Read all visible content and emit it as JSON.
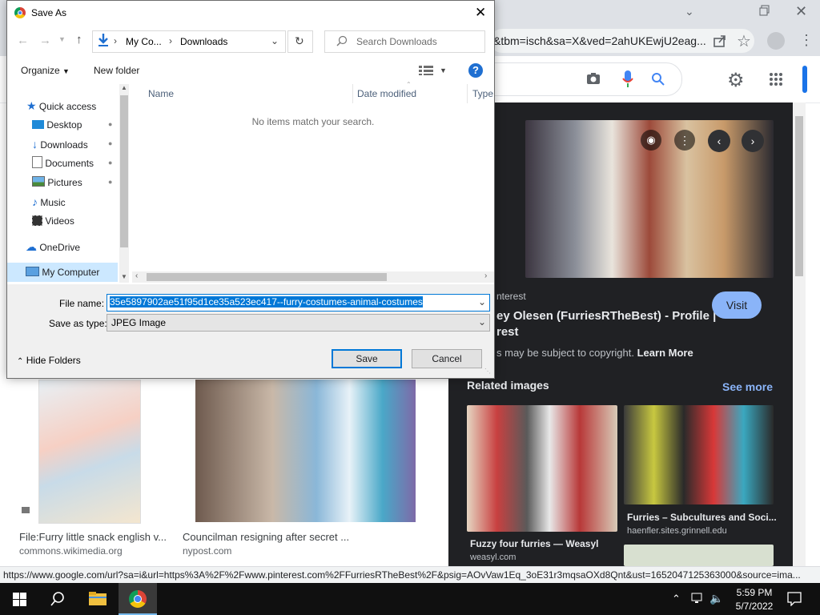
{
  "browser": {
    "url": "&tbm=isch&sa=X&ved=2ahUKEwjU2eag...",
    "status_url": "https://www.google.com/url?sa=i&url=https%3A%2F%2Fwww.pinterest.com%2FFurriesRTheBest%2F&psig=AOvVaw1Eq_3oE31r3mqsaOXd8Qnt&ust=1652047125363000&source=ima..."
  },
  "google": {
    "panel": {
      "source": "nterest",
      "title_line1": "ey Olesen (FurriesRTheBest) - Profile |",
      "title_line2": "rest",
      "visit_label": "Visit",
      "copyright": "s may be subject to copyright.",
      "learn_more": "Learn More",
      "related_label": "Related images",
      "see_more": "See more",
      "related": [
        {
          "title": "Fuzzy four furries — Weasyl",
          "source": "weasyl.com"
        },
        {
          "title": "Furries – Subcultures and Soci...",
          "source": "haenfler.sites.grinnell.edu"
        }
      ]
    },
    "results": [
      {
        "title": "File:Furry little snack english v...",
        "source": "commons.wikimedia.org"
      },
      {
        "title": "Councilman resigning after secret ...",
        "source": "nypost.com"
      }
    ]
  },
  "dialog": {
    "title": "Save As",
    "breadcrumb": [
      "My Co...",
      "Downloads"
    ],
    "search_placeholder": "Search Downloads",
    "organize_label": "Organize",
    "new_folder_label": "New folder",
    "nav_items": [
      {
        "label": "Quick access",
        "icon": "star-icon"
      },
      {
        "label": "Desktop",
        "icon": "desktop-icon"
      },
      {
        "label": "Downloads",
        "icon": "download-arrow-icon"
      },
      {
        "label": "Documents",
        "icon": "document-icon"
      },
      {
        "label": "Pictures",
        "icon": "pictures-icon"
      },
      {
        "label": "Music",
        "icon": "music-icon"
      },
      {
        "label": "Videos",
        "icon": "videos-icon"
      },
      {
        "label": "OneDrive",
        "icon": "cloud-icon"
      },
      {
        "label": "My Computer",
        "icon": "computer-icon"
      }
    ],
    "columns": [
      "Name",
      "Date modified",
      "Type"
    ],
    "empty_message": "No items match your search.",
    "file_name_label": "File name:",
    "file_name_value": "35e5897902ae51f95d1ce35a523ec417--furry-costumes-animal-costumes",
    "save_type_label": "Save as type:",
    "save_type_value": "JPEG Image",
    "hide_folders_label": "Hide Folders",
    "save_label": "Save",
    "cancel_label": "Cancel"
  },
  "taskbar": {
    "time": "5:59 PM",
    "date": "5/7/2022"
  },
  "colors": {
    "accent": "#0078d7",
    "selection": "#0078d7",
    "google_blue": "#8ab4f8",
    "panel_bg": "#202124"
  }
}
